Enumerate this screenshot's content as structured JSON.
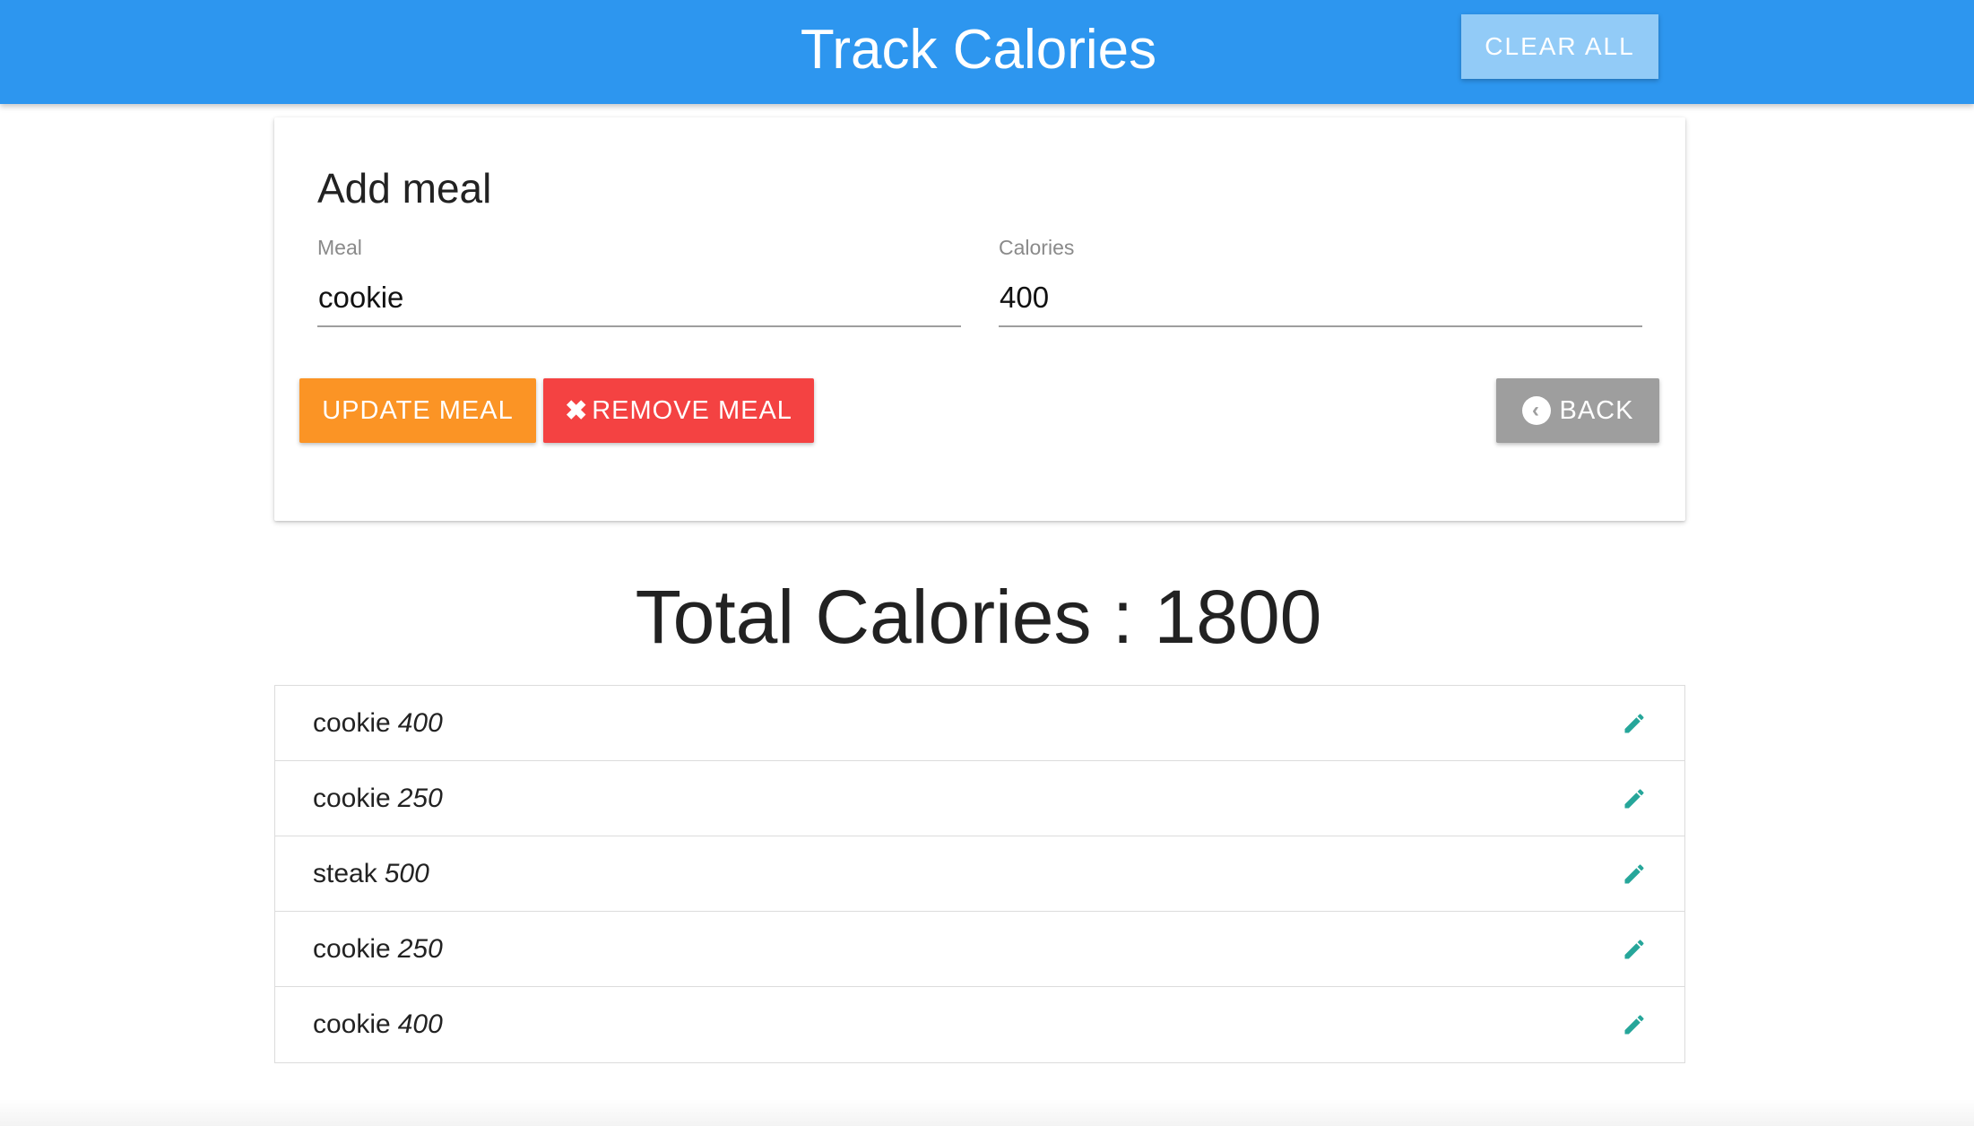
{
  "navbar": {
    "title": "Track Calories",
    "clear_label": "CLEAR ALL"
  },
  "form": {
    "title": "Add meal",
    "meal_label": "Meal",
    "meal_value": "cookie",
    "calories_label": "Calories",
    "calories_value": "400",
    "update_label": "UPDATE MEAL",
    "remove_label": "REMOVE MEAL",
    "back_label": "BACK"
  },
  "total": {
    "text": "Total Calories : 1800"
  },
  "items": [
    {
      "name": "cookie",
      "calories": "400"
    },
    {
      "name": "cookie",
      "calories": "250"
    },
    {
      "name": "steak",
      "calories": "500"
    },
    {
      "name": "cookie",
      "calories": "250"
    },
    {
      "name": "cookie",
      "calories": "400"
    }
  ],
  "icons": {
    "edit": "pencil-icon",
    "remove": "x-mark-icon",
    "back": "chevron-circle-left-icon"
  },
  "colors": {
    "navbar": "#2d96ef",
    "clear_button": "#92cbf7",
    "update_button": "#fb9425",
    "remove_button": "#f44242",
    "back_button": "#9e9e9e",
    "edit_icon": "#26a69a"
  }
}
